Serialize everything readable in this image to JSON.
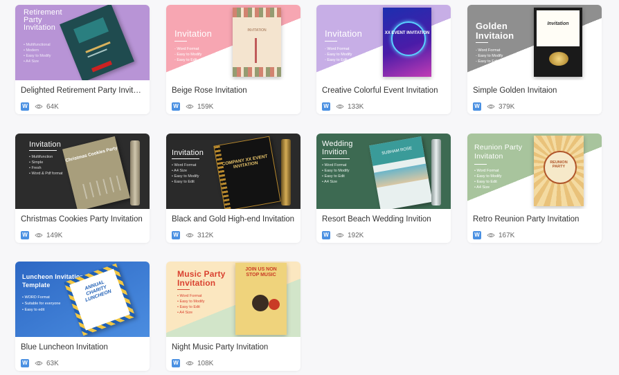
{
  "cards": [
    {
      "title": "Delighted Retirement Party Invitation",
      "views": "64K",
      "thumb": {
        "heading": "Retirement Party Invitation",
        "bullets": [
          "• Multifunctional",
          "• Modern",
          "• Easy to Modify",
          "• A4 Size"
        ]
      }
    },
    {
      "title": "Beige Rose Invitation",
      "views": "159K",
      "thumb": {
        "heading": "Invitation",
        "bullets": [
          "- Word Format",
          "- Easy to Modify",
          "- Easy to Edit"
        ],
        "doc_text": "INVITATION"
      }
    },
    {
      "title": "Creative Colorful Event Invitation",
      "views": "133K",
      "thumb": {
        "heading": "Invitation",
        "bullets": [
          "- Word Format",
          "- Easy to Modify",
          "- Easy to Edit"
        ],
        "doc_text": "XX EVENT INVITATION"
      }
    },
    {
      "title": "Simple Golden Invitaion",
      "views": "379K",
      "thumb": {
        "heading": "Golden Invitaion",
        "bullets": [
          "- Word Format",
          "- Easy to Modify",
          "- Easy to Edit"
        ],
        "doc_text": "Invitation"
      }
    },
    {
      "title": "Christmas Cookies Party Invitation",
      "views": "149K",
      "thumb": {
        "heading": "Invitation",
        "bullets": [
          "• Multifunction",
          "• Simple",
          "• Fresh",
          "• Word & Pdf format"
        ],
        "doc_text": "Christmas Cookies Party"
      }
    },
    {
      "title": "Black and Gold High-end Invitation",
      "views": "312K",
      "thumb": {
        "heading": "Invitation",
        "bullets": [
          "• Word Format",
          "• A4 Size",
          "• Easy to Modify",
          "• Easy to Edit"
        ],
        "doc_text": "COMPANY XX EVENT INVITATION"
      }
    },
    {
      "title": "Resort Beach Wedding Invition",
      "views": "192K",
      "thumb": {
        "heading": "Wedding Invition",
        "bullets": [
          "• Word Format",
          "• Easy to Modify",
          "• Easy to Edit",
          "• A4 Size"
        ],
        "doc_text": "SUBHAM ROSE"
      }
    },
    {
      "title": "Retro Reunion Party Invitation",
      "views": "167K",
      "thumb": {
        "heading": "Reunion Party Invitaton",
        "bullets": [
          "• Word Format",
          "• Easy to Modify",
          "• Easy to Edit",
          "• A4 Size"
        ],
        "doc_text": "REUNION PARTY"
      }
    },
    {
      "title": "Blue Luncheon Invitation",
      "views": "63K",
      "thumb": {
        "heading": "Luncheon Invitation Template",
        "bullets": [
          "• WORD Format",
          "• Suitable for everyone",
          "• Easy to edit"
        ],
        "doc_text": "ANNUAL CHARITY LUNCHEON"
      }
    },
    {
      "title": "Night Music Party Invitation",
      "views": "108K",
      "thumb": {
        "heading": "Music Party Invitation",
        "bullets": [
          "• Word Format",
          "• Easy to Modify",
          "• Easy to Edit",
          "• A4 Size"
        ],
        "doc_text": "JOIN US NON STOP MUSIC"
      }
    }
  ],
  "colors": {
    "word_badge": "#4a90e2",
    "title_text": "#333333",
    "views_text": "#666666"
  },
  "icons": {
    "badge": "word-icon",
    "views": "eye-icon"
  }
}
